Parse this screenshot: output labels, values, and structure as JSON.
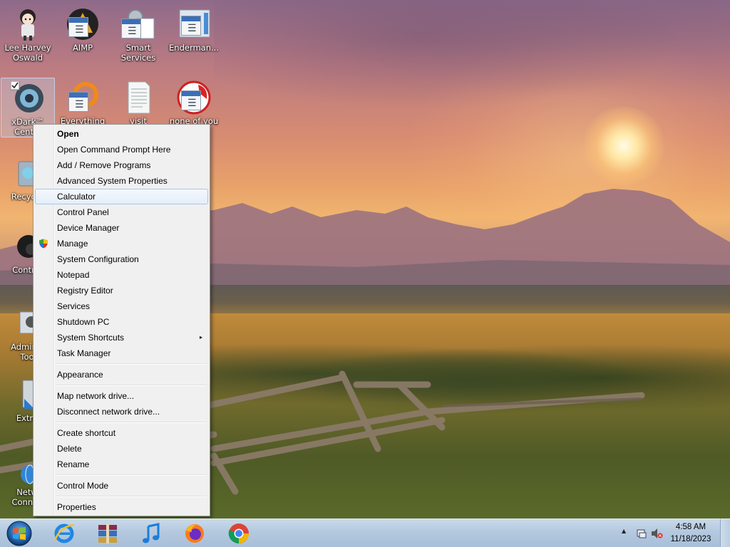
{
  "desktop": {
    "icons": [
      {
        "label": "Lee Harvey\nOswald",
        "icon": "anime-character-icon"
      },
      {
        "label": "AIMP",
        "icon": "aimp-icon"
      },
      {
        "label": "Smart\nServices",
        "icon": "gear-window-icon"
      },
      {
        "label": "Enderman...",
        "icon": "window-icon"
      },
      {
        "label": "xDark™\nCent...",
        "icon": "xdark-center-icon"
      },
      {
        "label": "Everything",
        "icon": "everything-search-icon"
      },
      {
        "label": "visit",
        "icon": "document-icon"
      },
      {
        "label": "none of you\n...",
        "icon": "window-icon"
      },
      {
        "label": "Recycle",
        "icon": "recycle-bin-icon"
      },
      {
        "label": "Control",
        "icon": "control-panel-icon"
      },
      {
        "label": "Adminis\nToo",
        "icon": "admin-tools-icon"
      },
      {
        "label": "Extra",
        "icon": "extras-icon"
      },
      {
        "label": "Netw\nConnec",
        "icon": "network-icon"
      }
    ]
  },
  "context_menu": {
    "items": [
      {
        "label": "Open",
        "bold": true
      },
      {
        "label": "Open Command Prompt Here"
      },
      {
        "label": "Add / Remove Programs"
      },
      {
        "label": "Advanced System Properties"
      },
      {
        "label": "Calculator",
        "highlighted": true
      },
      {
        "label": "Control Panel"
      },
      {
        "label": "Device Manager"
      },
      {
        "label": "Manage",
        "icon": "shield-icon"
      },
      {
        "label": "System Configuration"
      },
      {
        "label": "Notepad"
      },
      {
        "label": "Registry Editor"
      },
      {
        "label": "Services"
      },
      {
        "label": "Shutdown PC"
      },
      {
        "label": "System Shortcuts",
        "submenu": true,
        "arrow": "▸"
      },
      {
        "label": "Task Manager"
      },
      {
        "separator": true
      },
      {
        "label": "Appearance"
      },
      {
        "separator": true
      },
      {
        "label": "Map network drive..."
      },
      {
        "label": "Disconnect network drive..."
      },
      {
        "separator": true
      },
      {
        "label": "Create shortcut"
      },
      {
        "label": "Delete"
      },
      {
        "label": "Rename"
      },
      {
        "separator": true
      },
      {
        "label": "Control Mode"
      },
      {
        "separator": true
      },
      {
        "label": "Properties"
      }
    ]
  },
  "taskbar": {
    "pinned": [
      {
        "name": "internet-explorer-icon"
      },
      {
        "name": "winrar-icon"
      },
      {
        "name": "music-note-icon"
      },
      {
        "name": "firefox-icon"
      },
      {
        "name": "chrome-icon"
      }
    ],
    "tray": {
      "time": "4:58 AM",
      "date": "11/18/2023",
      "show_hidden_glyph": "▲"
    }
  },
  "colors": {
    "menu_bg": "#f0f0f0",
    "menu_highlight": "#e4eef9",
    "taskbar": "#b4c9df"
  }
}
